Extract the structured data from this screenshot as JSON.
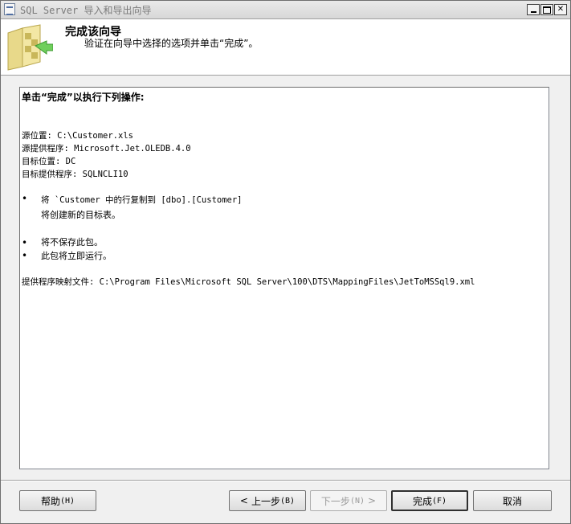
{
  "window": {
    "title": "SQL Server 导入和导出向导",
    "title_color": "#7a7a7a"
  },
  "header": {
    "title": "完成该向导",
    "subtitle": "验证在向导中选择的选项并单击“完成”。",
    "icon": "wizard-folder-icon"
  },
  "summary": {
    "heading": "单击“完成”以执行下列操作:",
    "source_location": "源位置: C:\\Customer.xls",
    "source_provider": "源提供程序: Microsoft.Jet.OLEDB.4.0",
    "dest_location": "目标位置: DC",
    "dest_provider": "目标提供程序: SQLNCLI10",
    "copy_bullet": "将 `Customer 中的行复制到 [dbo].[Customer]",
    "copy_note": "将创建新的目标表。",
    "no_save_bullet": "将不保存此包。",
    "run_bullet": "此包将立即运行。",
    "mapping_file": "提供程序映射文件: C:\\Program Files\\Microsoft SQL Server\\100\\DTS\\MappingFiles\\JetToMSSql9.xml",
    "bullet_char": "•"
  },
  "buttons": {
    "help": "帮助",
    "help_hotkey": "(H)",
    "back": "上一步",
    "back_hotkey": "(B)",
    "next": "下一步",
    "next_hotkey": "(N)",
    "finish": "完成",
    "finish_hotkey": "(F)",
    "cancel": "取消",
    "back_arrow": "<",
    "next_arrow": ">"
  }
}
